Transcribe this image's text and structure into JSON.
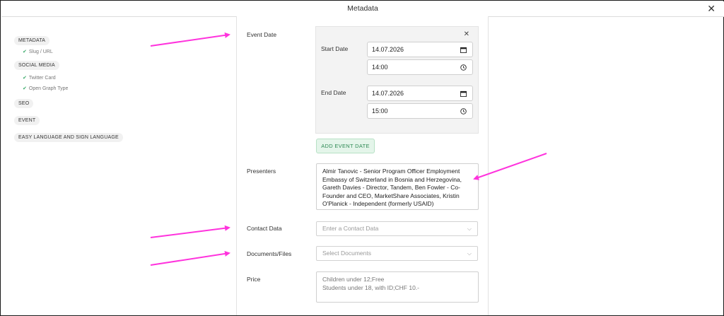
{
  "window": {
    "title": "Metadata",
    "close_icon": "close-icon"
  },
  "nav": {
    "items": [
      {
        "label": "METADATA",
        "subs": [
          "Slug / URL"
        ]
      },
      {
        "label": "SOCIAL MEDIA",
        "subs": [
          "Twitter Card",
          "Open Graph Type"
        ]
      },
      {
        "label": "SEO",
        "subs": []
      },
      {
        "label": "EVENT",
        "subs": []
      },
      {
        "label": "EASY LANGUAGE AND SIGN LANGUAGE",
        "subs": []
      }
    ],
    "check_glyph": "✔"
  },
  "form": {
    "event_date_label": "Event Date",
    "start_date_label": "Start Date",
    "start_date": "14.07.2026",
    "start_time": "14:00",
    "end_date_label": "End Date",
    "end_date": "14.07.2026",
    "end_time": "15:00",
    "add_event_date": "ADD EVENT DATE",
    "presenters_label": "Presenters",
    "presenters_value": "Almir Tanovic - Senior Program Officer Employment\nEmbassy of Switzerland in Bosnia and Herzegovina,\nGareth Davies - Director, Tandem, Ben Fowler - Co-\nFounder and CEO, MarketShare Associates, Kristin\nO'Planick - Independent (formerly USAID)",
    "contact_label": "Contact Data",
    "contact_placeholder": "Enter a Contact Data",
    "documents_label": "Documents/Files",
    "documents_placeholder": "Select Documents",
    "price_label": "Price",
    "price_value": "Children under 12;Free\nStudents under 18, with ID;CHF 10.-"
  },
  "colors": {
    "accent_green": "#2f8a55",
    "annotation_arrow": "#ff33dd"
  }
}
